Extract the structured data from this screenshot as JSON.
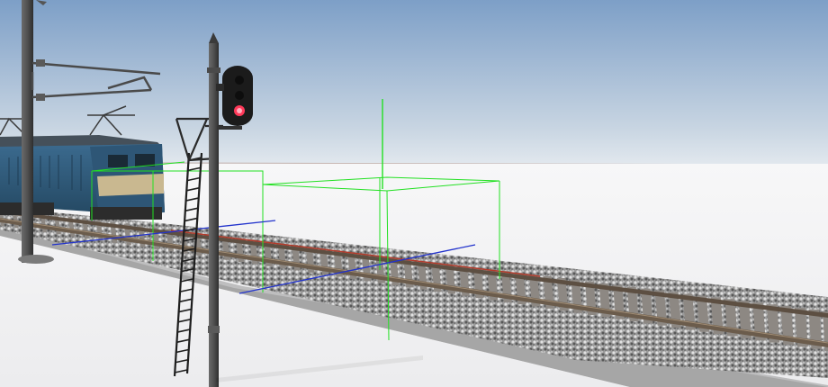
{
  "viewport": {
    "description_free": true
  },
  "colors": {
    "sky_top": "#7fa0c8",
    "sky_horizon": "#dfe6ee",
    "ground": "#f4f5f6",
    "ballast_dark": "#6b6b6b",
    "ballast_light": "#cfcfcf",
    "rail": "#6a5a4a",
    "rail_highlight": "#b03a2a",
    "sleeper": "#8a8580",
    "embankment": "#a8a8a8",
    "pole": "#4a4a4a",
    "locomotive_body": "#2f5878",
    "locomotive_roof": "#3c4650",
    "signal_head": "#1c1c1c",
    "signal_lamp_red": "#ff3a5a",
    "gizmo_green": "#22dd22",
    "gizmo_blue": "#2233cc"
  },
  "icons": {
    "signal": "railway-signal-icon",
    "ladder": "ladder-icon",
    "catenary": "catenary-pole-icon",
    "locomotive": "electric-locomotive-icon",
    "gizmo": "bounding-box-gizmo-icon"
  },
  "signal": {
    "aspect": "red"
  }
}
